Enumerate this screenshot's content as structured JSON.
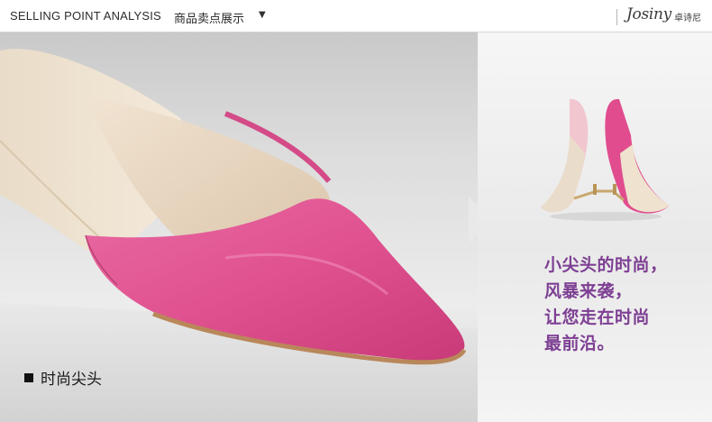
{
  "header": {
    "title_en": "SELLING POINT ANALYSIS",
    "title_cn": "商品卖点展示",
    "caret": "▼",
    "brand": "Josiny",
    "brand_cn": "卓诗尼"
  },
  "feature": {
    "caption": "时尚尖头"
  },
  "promo": {
    "lines": [
      "小尖头的时尚，",
      "风暴来袭，",
      "让您走在时尚",
      "最前沿。"
    ]
  },
  "colors": {
    "pink": "#e04c8e",
    "nude": "#efe2cf",
    "purple_text": "#7d3f93"
  },
  "icons": {
    "square_bullet": "black-square-icon",
    "caret": "triangle-down-icon"
  }
}
